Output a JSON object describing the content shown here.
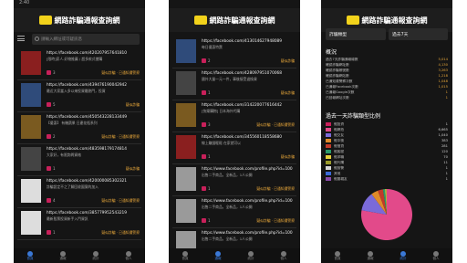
{
  "app": {
    "title": "網路詐騙通報查詢網"
  },
  "phone1": {
    "status": "2:40",
    "search_placeholder": "請輸入網址或可疑訊息",
    "items": [
      {
        "url": "https://facebook.com/420207957641810",
        "desc": "[限時]家人-好物推薦 / 超多款式搶購",
        "count": "3",
        "tag": "疑似詐騙 · 已通知遭警察"
      },
      {
        "url": "https://facebook.com/439476190042942",
        "desc": "最近大家當入多以來投資最熱門，投資",
        "count": "5",
        "tag": "疑似詐騙"
      },
      {
        "url": "https://facebook.com/450543228133449",
        "desc": "【優惠】 有機蔬果 日產花瓶系列",
        "count": "2",
        "tag": "疑似詐騙 · 已通知遭警察"
      },
      {
        "url": "https://facebook.com/483598179174814",
        "desc": "大家好，有限詢問資格",
        "count": "1",
        "tag": "疑似詐騙"
      },
      {
        "url": "https://facebook.com/420000085302321",
        "desc": "詐騙設定不之了解回收圖案的加入",
        "count": "4",
        "tag": "疑似詐騙 · 已通知遭警察"
      },
      {
        "url": "https://facebook.com/385779952543219",
        "desc": "最新股票投資新手入門資訊",
        "count": "1",
        "tag": "疑似詐騙 · 已通知遭警察"
      }
    ],
    "tabs": [
      "首頁",
      "通報",
      "統計",
      "個人"
    ]
  },
  "phone2": {
    "items": [
      {
        "url": "https://facebook.com/413014627948089",
        "desc": "每日優惠特賣",
        "count": "2",
        "tag": "疑似詐騙"
      },
      {
        "url": "https://facebook.com/428097951070068",
        "desc": "國外大量一元一件，事後接受退換貨",
        "count": "1",
        "tag": "疑似詐騙"
      },
      {
        "url": "https://facebook.com/314220077616442",
        "desc": "[快樂購物] 日本海外代購",
        "count": "3",
        "tag": "疑似詐騙 · 已通知遭警察"
      },
      {
        "url": "https://facebook.com/345560118558680",
        "desc": "線上賺錢輕鬆 在家就可以",
        "count": "1",
        "tag": "疑似詐騙"
      },
      {
        "url": "https://www.facebook.com/profile.php?id=100",
        "desc": "出售二手商品，全新品，1人公開",
        "count": "1",
        "tag": "疑似詐騙 · 已通知遭警察"
      },
      {
        "url": "https://www.facebook.com/profile.php?id=100",
        "desc": "出售二手商品，全新品，1人公開",
        "count": "1",
        "tag": "疑似詐騙 · 已通知遭警察"
      },
      {
        "url": "https://www.facebook.com/profile.php?id=100",
        "desc": "出售二手商品，全新品，1人公開",
        "count": "1",
        "tag": "疑似詐騙 · 已通知遭警察"
      }
    ],
    "tabs": [
      "首頁",
      "通報",
      "統計",
      "個人"
    ]
  },
  "phone3": {
    "filter1": "詐騙類型",
    "filter2": "過去7天",
    "overview_title": "概況",
    "summary": [
      {
        "label": "過去7天詐騙通報總數",
        "value": "5,014"
      },
      {
        "label": "確認詐騙網址數",
        "value": "4,130"
      },
      {
        "label": "確認詐騙帳號數",
        "value": "3,263"
      },
      {
        "label": "確認詐騙網站數",
        "value": "1,218"
      },
      {
        "label": "已通知遭警察次數",
        "value": "1,048"
      },
      {
        "label": "已通報Facebook次數",
        "value": "1,015"
      },
      {
        "label": "已通報Google次數",
        "value": "1"
      },
      {
        "label": "已回報網址次數",
        "value": "1"
      }
    ],
    "ratio_title": "過去一天詐騙類型比例",
    "legend": [
      {
        "label": "假投資",
        "value": "1",
        "color": "#c8205a"
      },
      {
        "label": "假網拍",
        "value": "6,665",
        "color": "#e24a8a"
      },
      {
        "label": "假交友",
        "value": "1,040",
        "color": "#7a6ad8"
      },
      {
        "label": "假中獎",
        "value": "383",
        "color": "#e08a2a"
      },
      {
        "label": "假借貸",
        "value": "281",
        "color": "#c23a2a"
      },
      {
        "label": "假客服",
        "value": "120",
        "color": "#2a9a6a"
      },
      {
        "label": "假求職",
        "value": "70",
        "color": "#e6d23a"
      },
      {
        "label": "假代購",
        "value": "11",
        "color": "#9a9a2a"
      },
      {
        "label": "假檢警",
        "value": "1",
        "color": "#d8d8d8"
      },
      {
        "label": "其他",
        "value": "1",
        "color": "#3a6ad8"
      },
      {
        "label": "假冒親友",
        "value": "1",
        "color": "#8a4aaa"
      }
    ],
    "tabs": [
      "首頁",
      "通報",
      "統計",
      "個人"
    ]
  }
}
